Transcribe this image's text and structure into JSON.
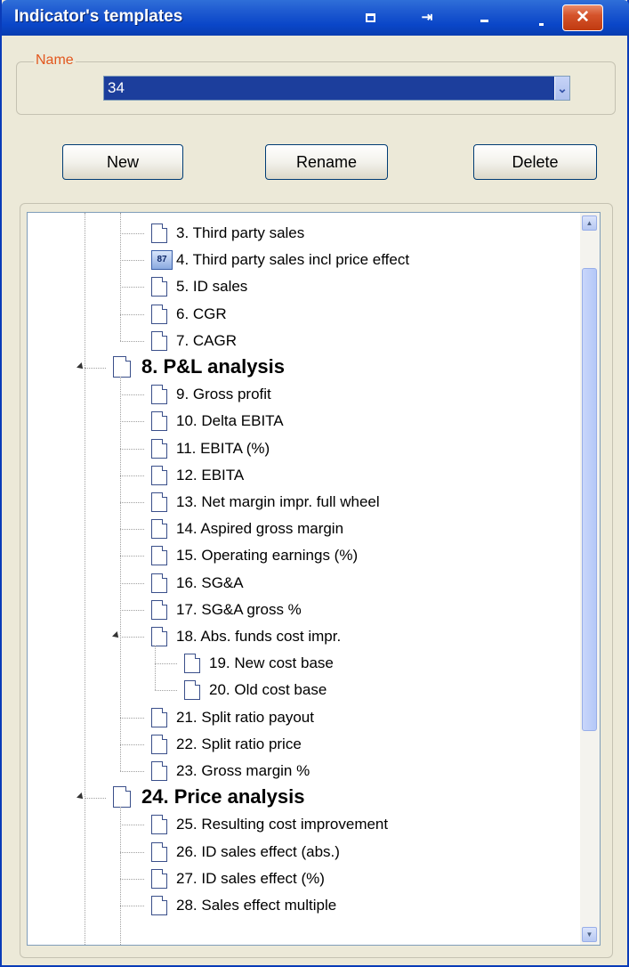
{
  "window": {
    "title": "Indicator's templates",
    "accent": "#0a46c8",
    "close_color": "#c03a10",
    "icons": [
      "restore-icon",
      "pin-icon",
      "minimize-icon",
      "minimize-small-icon",
      "close-icon"
    ],
    "close_glyph": "✕"
  },
  "name_group": {
    "label": "Name",
    "label_color": "#e2571e",
    "value": "34",
    "dropdown_icon": "chevron-down-icon"
  },
  "buttons": {
    "new": "New",
    "rename": "Rename",
    "delete": "Delete"
  },
  "tree": {
    "items": [
      {
        "label": "3. Third party sales",
        "level": 1,
        "icon": "document-icon"
      },
      {
        "label": "4. Third party sales incl price effect",
        "level": 1,
        "icon": "calculator-icon"
      },
      {
        "label": "5. ID sales",
        "level": 1,
        "icon": "document-icon"
      },
      {
        "label": "6. CGR",
        "level": 1,
        "icon": "document-icon"
      },
      {
        "label": "7. CAGR",
        "level": 1,
        "icon": "document-icon"
      },
      {
        "label": "8. P&L analysis",
        "level": 0,
        "icon": "document-icon",
        "expanded": true,
        "bold": true
      },
      {
        "label": "9. Gross profit",
        "level": 1,
        "icon": "document-icon"
      },
      {
        "label": "10. Delta EBITA",
        "level": 1,
        "icon": "document-icon"
      },
      {
        "label": "11. EBITA (%)",
        "level": 1,
        "icon": "document-icon"
      },
      {
        "label": "12. EBITA",
        "level": 1,
        "icon": "document-icon"
      },
      {
        "label": "13. Net margin impr. full wheel",
        "level": 1,
        "icon": "document-icon"
      },
      {
        "label": "14. Aspired gross margin",
        "level": 1,
        "icon": "document-icon"
      },
      {
        "label": "15. Operating earnings (%)",
        "level": 1,
        "icon": "document-icon"
      },
      {
        "label": "16. SG&A",
        "level": 1,
        "icon": "document-icon"
      },
      {
        "label": "17. SG&A gross %",
        "level": 1,
        "icon": "document-icon"
      },
      {
        "label": "18. Abs. funds cost impr.",
        "level": 1,
        "icon": "document-icon",
        "expanded": true
      },
      {
        "label": "19. New cost base",
        "level": 2,
        "icon": "document-icon"
      },
      {
        "label": "20. Old cost base",
        "level": 2,
        "icon": "document-icon"
      },
      {
        "label": "21. Split ratio payout",
        "level": 1,
        "icon": "document-icon"
      },
      {
        "label": "22. Split ratio price",
        "level": 1,
        "icon": "document-icon"
      },
      {
        "label": "23. Gross margin %",
        "level": 1,
        "icon": "document-icon"
      },
      {
        "label": "24. Price analysis",
        "level": 0,
        "icon": "document-icon",
        "expanded": true,
        "bold": true
      },
      {
        "label": "25. Resulting cost improvement",
        "level": 1,
        "icon": "document-icon"
      },
      {
        "label": "26. ID sales effect (abs.)",
        "level": 1,
        "icon": "document-icon"
      },
      {
        "label": "27. ID sales effect (%)",
        "level": 1,
        "icon": "document-icon"
      },
      {
        "label": "28. Sales effect multiple",
        "level": 1,
        "icon": "document-icon"
      }
    ],
    "scrollbar": {
      "up_icon": "scroll-up-icon",
      "down_icon": "scroll-down-icon"
    }
  }
}
